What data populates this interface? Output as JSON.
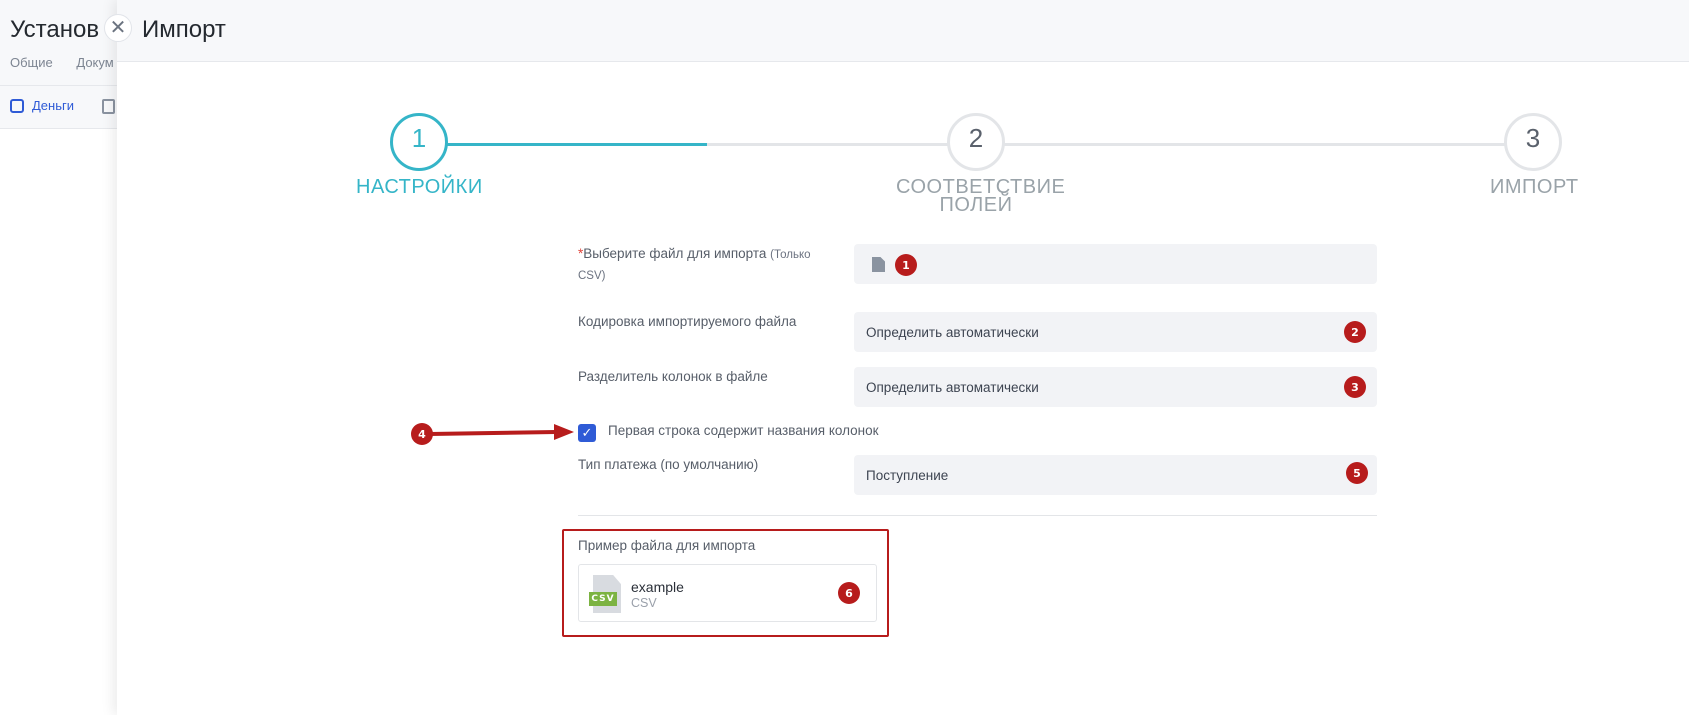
{
  "background": {
    "title": "Установ",
    "tabs": [
      "Общие",
      "Докум"
    ],
    "toolbar_item": "Деньги"
  },
  "panel": {
    "title": "Импорт",
    "close_symbol": "✕"
  },
  "stepper": {
    "steps": [
      {
        "number": "1",
        "label": "НАСТРОЙКИ",
        "active": true
      },
      {
        "number": "2",
        "label_line1": "СООТВЕТСТВИЕ",
        "label_line2": "ПОЛЕЙ",
        "active": false
      },
      {
        "number": "3",
        "label": "ИМПОРТ",
        "active": false
      }
    ],
    "progress_fraction": 0.5
  },
  "form": {
    "file": {
      "required_mark": "*",
      "label": "Выберите файл для импорта",
      "hint_1": "(Только",
      "hint_2": "CSV)",
      "badge": "1"
    },
    "encoding": {
      "label": "Кодировка импортируемого файла",
      "value": "Определить автоматически",
      "badge": "2"
    },
    "delimiter": {
      "label": "Разделитель колонок в файле",
      "value": "Определить автоматически",
      "badge": "3"
    },
    "header_row": {
      "label": "Первая строка содержит названия колонок",
      "checked": true,
      "check_symbol": "✓",
      "badge": "4"
    },
    "payment_type": {
      "label": "Тип платежа (по умолчанию)",
      "value": "Поступление",
      "badge": "5"
    }
  },
  "example": {
    "label": "Пример файла для импорта",
    "file_name": "example",
    "file_ext": "CSV",
    "icon_text": "CSV",
    "badge": "6"
  },
  "colors": {
    "accent": "#35b5c8",
    "checkbox": "#2f5bd6",
    "annotation": "#b71c1c"
  }
}
